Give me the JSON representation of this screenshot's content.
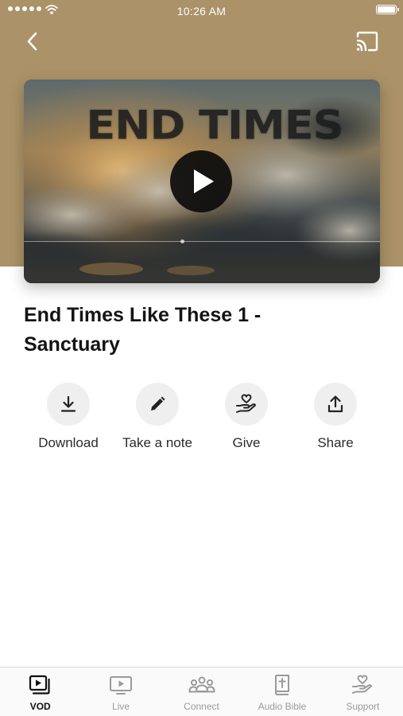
{
  "status_bar": {
    "time": "10:26 AM"
  },
  "video": {
    "artwork_title": "END TIMES",
    "play_icon": "play-icon"
  },
  "sermon": {
    "title": "End Times Like These 1 - Sanctuary"
  },
  "actions": [
    {
      "label": "Download",
      "icon": "download-icon"
    },
    {
      "label": "Take a note",
      "icon": "pencil-icon"
    },
    {
      "label": "Give",
      "icon": "hand-heart-icon"
    },
    {
      "label": "Share",
      "icon": "share-icon"
    }
  ],
  "tabs": [
    {
      "label": "VOD",
      "icon": "video-library-icon",
      "active": true
    },
    {
      "label": "Live",
      "icon": "tv-play-icon",
      "active": false
    },
    {
      "label": "Connect",
      "icon": "people-icon",
      "active": false
    },
    {
      "label": "Audio Bible",
      "icon": "bible-icon",
      "active": false
    },
    {
      "label": "Support",
      "icon": "hand-heart-icon",
      "active": false
    }
  ],
  "colors": {
    "header_background": "#ab9268",
    "tab_active": "#111111",
    "tab_inactive": "#9a9a9a",
    "action_circle": "#efefef"
  }
}
